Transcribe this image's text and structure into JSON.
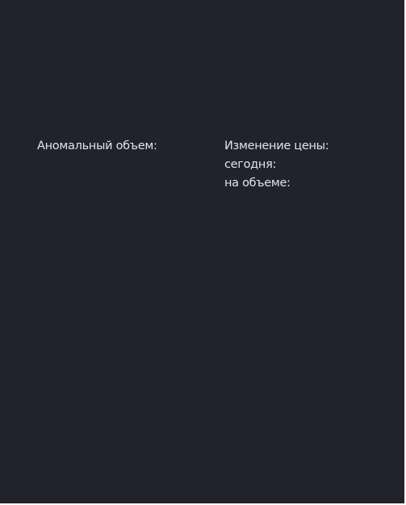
{
  "widget": {
    "anomalous_volume_label": "Аномальный объем:",
    "price_change_label": "Изменение цены:",
    "today_label": "сегодня:",
    "on_volume_label": "на объеме:"
  }
}
